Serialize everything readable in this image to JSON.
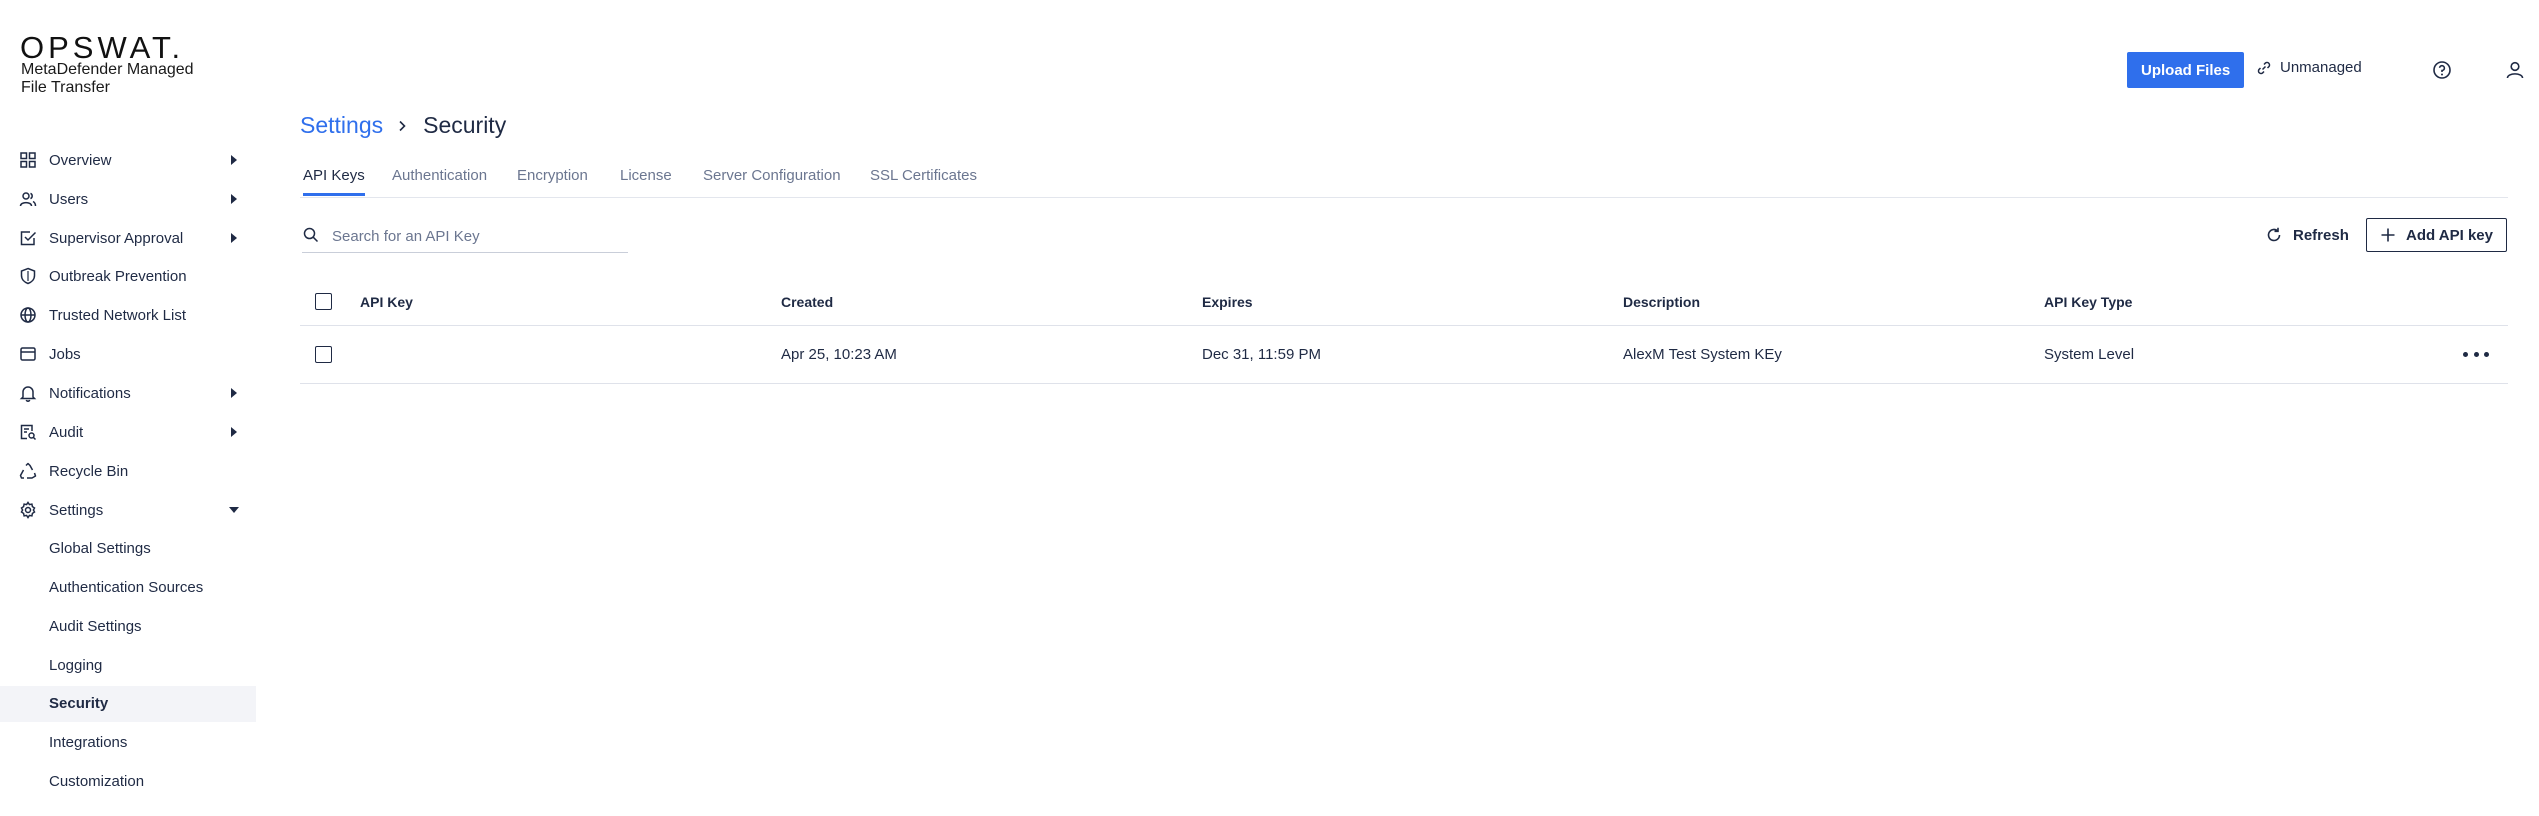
{
  "brand": {
    "logo_text": "OPSWAT.",
    "product_name": "MetaDefender Managed File Transfer"
  },
  "sidebar": {
    "items": [
      {
        "label": "Overview",
        "icon": "grid-icon",
        "has_caret": true
      },
      {
        "label": "Users",
        "icon": "users-icon",
        "has_caret": true
      },
      {
        "label": "Supervisor Approval",
        "icon": "checklist-icon",
        "has_caret": true
      },
      {
        "label": "Outbreak Prevention",
        "icon": "shield-icon",
        "has_caret": false
      },
      {
        "label": "Trusted Network List",
        "icon": "globe-icon",
        "has_caret": false
      },
      {
        "label": "Jobs",
        "icon": "calendar-icon",
        "has_caret": false
      },
      {
        "label": "Notifications",
        "icon": "bell-icon",
        "has_caret": true
      },
      {
        "label": "Audit",
        "icon": "audit-icon",
        "has_caret": true
      },
      {
        "label": "Recycle Bin",
        "icon": "recycle-icon",
        "has_caret": false
      },
      {
        "label": "Settings",
        "icon": "gear-icon",
        "has_caret": true,
        "expanded": true
      }
    ],
    "settings_children": [
      {
        "label": "Global Settings"
      },
      {
        "label": "Authentication Sources"
      },
      {
        "label": "Audit Settings"
      },
      {
        "label": "Logging"
      },
      {
        "label": "Security",
        "active": true
      },
      {
        "label": "Integrations"
      },
      {
        "label": "Customization"
      }
    ]
  },
  "topbar": {
    "upload_label": "Upload Files",
    "unmanaged_label": "Unmanaged",
    "help_icon": "help-circle-icon",
    "user_icon": "user-icon"
  },
  "breadcrumb": {
    "parent": "Settings",
    "current": "Security"
  },
  "tabs": [
    {
      "label": "API Keys",
      "active": true
    },
    {
      "label": "Authentication"
    },
    {
      "label": "Encryption"
    },
    {
      "label": "License"
    },
    {
      "label": "Server Configuration"
    },
    {
      "label": "SSL Certificates"
    }
  ],
  "toolbar": {
    "search_placeholder": "Search for an API Key",
    "refresh_label": "Refresh",
    "add_label": "Add API key"
  },
  "table": {
    "columns": [
      "API Key",
      "Created",
      "Expires",
      "Description",
      "API Key Type"
    ],
    "rows": [
      {
        "api_key": "",
        "created": "Apr 25, 10:23 AM",
        "expires": "Dec 31, 11:59 PM",
        "description": "AlexM Test System KEy",
        "type": "System Level"
      }
    ]
  },
  "colors": {
    "accent": "#2f6fec",
    "text": "#1f2a44",
    "muted": "#6b7690",
    "active_row_bg": "#f3f4f8"
  }
}
